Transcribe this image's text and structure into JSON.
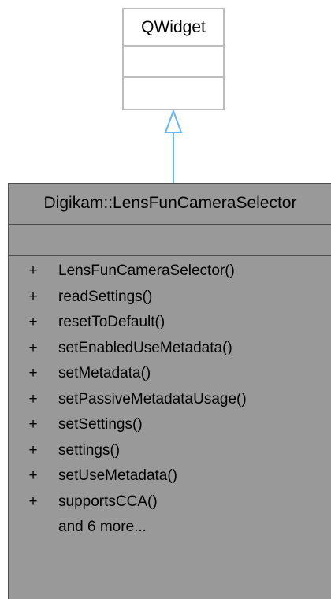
{
  "parent_class": {
    "name": "QWidget"
  },
  "class": {
    "name": "Digikam::LensFunCameraSelector",
    "methods": [
      {
        "visibility": "+",
        "name": "LensFunCameraSelector()"
      },
      {
        "visibility": "+",
        "name": "readSettings()"
      },
      {
        "visibility": "+",
        "name": "resetToDefault()"
      },
      {
        "visibility": "+",
        "name": "setEnabledUseMetadata()"
      },
      {
        "visibility": "+",
        "name": "setMetadata()"
      },
      {
        "visibility": "+",
        "name": "setPassiveMetadataUsage()"
      },
      {
        "visibility": "+",
        "name": "setSettings()"
      },
      {
        "visibility": "+",
        "name": "settings()"
      },
      {
        "visibility": "+",
        "name": "setUseMetadata()"
      },
      {
        "visibility": "+",
        "name": "supportsCCA()"
      }
    ],
    "more": "and 6 more..."
  },
  "colors": {
    "parent_border": "#bcbcbc",
    "class_fill": "#999999",
    "class_border": "#4d4d4d",
    "arrow": "#63b8ff"
  }
}
